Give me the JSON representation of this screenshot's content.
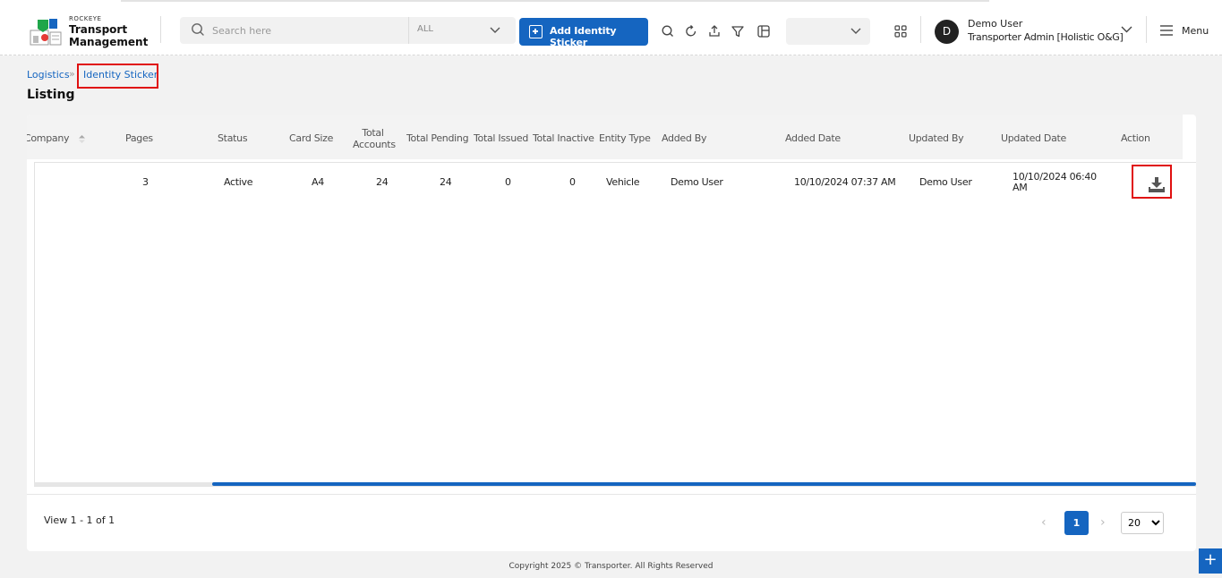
{
  "app": {
    "brand_small": "ROCKEYE",
    "brand_line1": "Transport",
    "brand_line2": "Management"
  },
  "header": {
    "search_placeholder": "Search here",
    "scope_value": "ALL",
    "add_button_label": "Add Identity Sticker",
    "user": {
      "initial": "D",
      "name": "Demo User",
      "role": "Transporter Admin [Holistic O&G]"
    },
    "menu_label": "Menu"
  },
  "breadcrumb": {
    "parent": "Logistics",
    "separator": "»",
    "current": "Identity Sticker"
  },
  "page_title": "Listing",
  "table": {
    "columns": [
      {
        "label": "Company"
      },
      {
        "label": "Pages"
      },
      {
        "label": "Status"
      },
      {
        "label": "Card Size"
      },
      {
        "label": "Total Accounts"
      },
      {
        "label": "Total Pending"
      },
      {
        "label": "Total Issued"
      },
      {
        "label": "Total Inactive"
      },
      {
        "label": "Entity Type"
      },
      {
        "label": "Added By"
      },
      {
        "label": "Added Date"
      },
      {
        "label": "Updated By"
      },
      {
        "label": "Updated Date"
      },
      {
        "label": "Action"
      }
    ],
    "total_accounts_l1": "Total",
    "total_accounts_l2": "Accounts",
    "rows": [
      {
        "company": "",
        "pages": "3",
        "status": "Active",
        "card_size": "A4",
        "total_accounts": "24",
        "total_pending": "24",
        "total_issued": "0",
        "total_inactive": "0",
        "entity_type": "Vehicle",
        "added_by": "Demo User",
        "added_date": "10/10/2024 07:37 AM",
        "updated_by": "Demo User",
        "updated_date_l1": "10/10/2024 06:40",
        "updated_date_l2": "AM"
      }
    ]
  },
  "pagination": {
    "view_text": "View 1 - 1 of 1",
    "current_page": "1",
    "page_size": "20",
    "page_size_options": [
      "20"
    ]
  },
  "footer": {
    "copyright": "Copyright 2025 © Transporter. All Rights Reserved"
  },
  "colors": {
    "accent": "#1565c0",
    "highlight": "#e01010"
  }
}
